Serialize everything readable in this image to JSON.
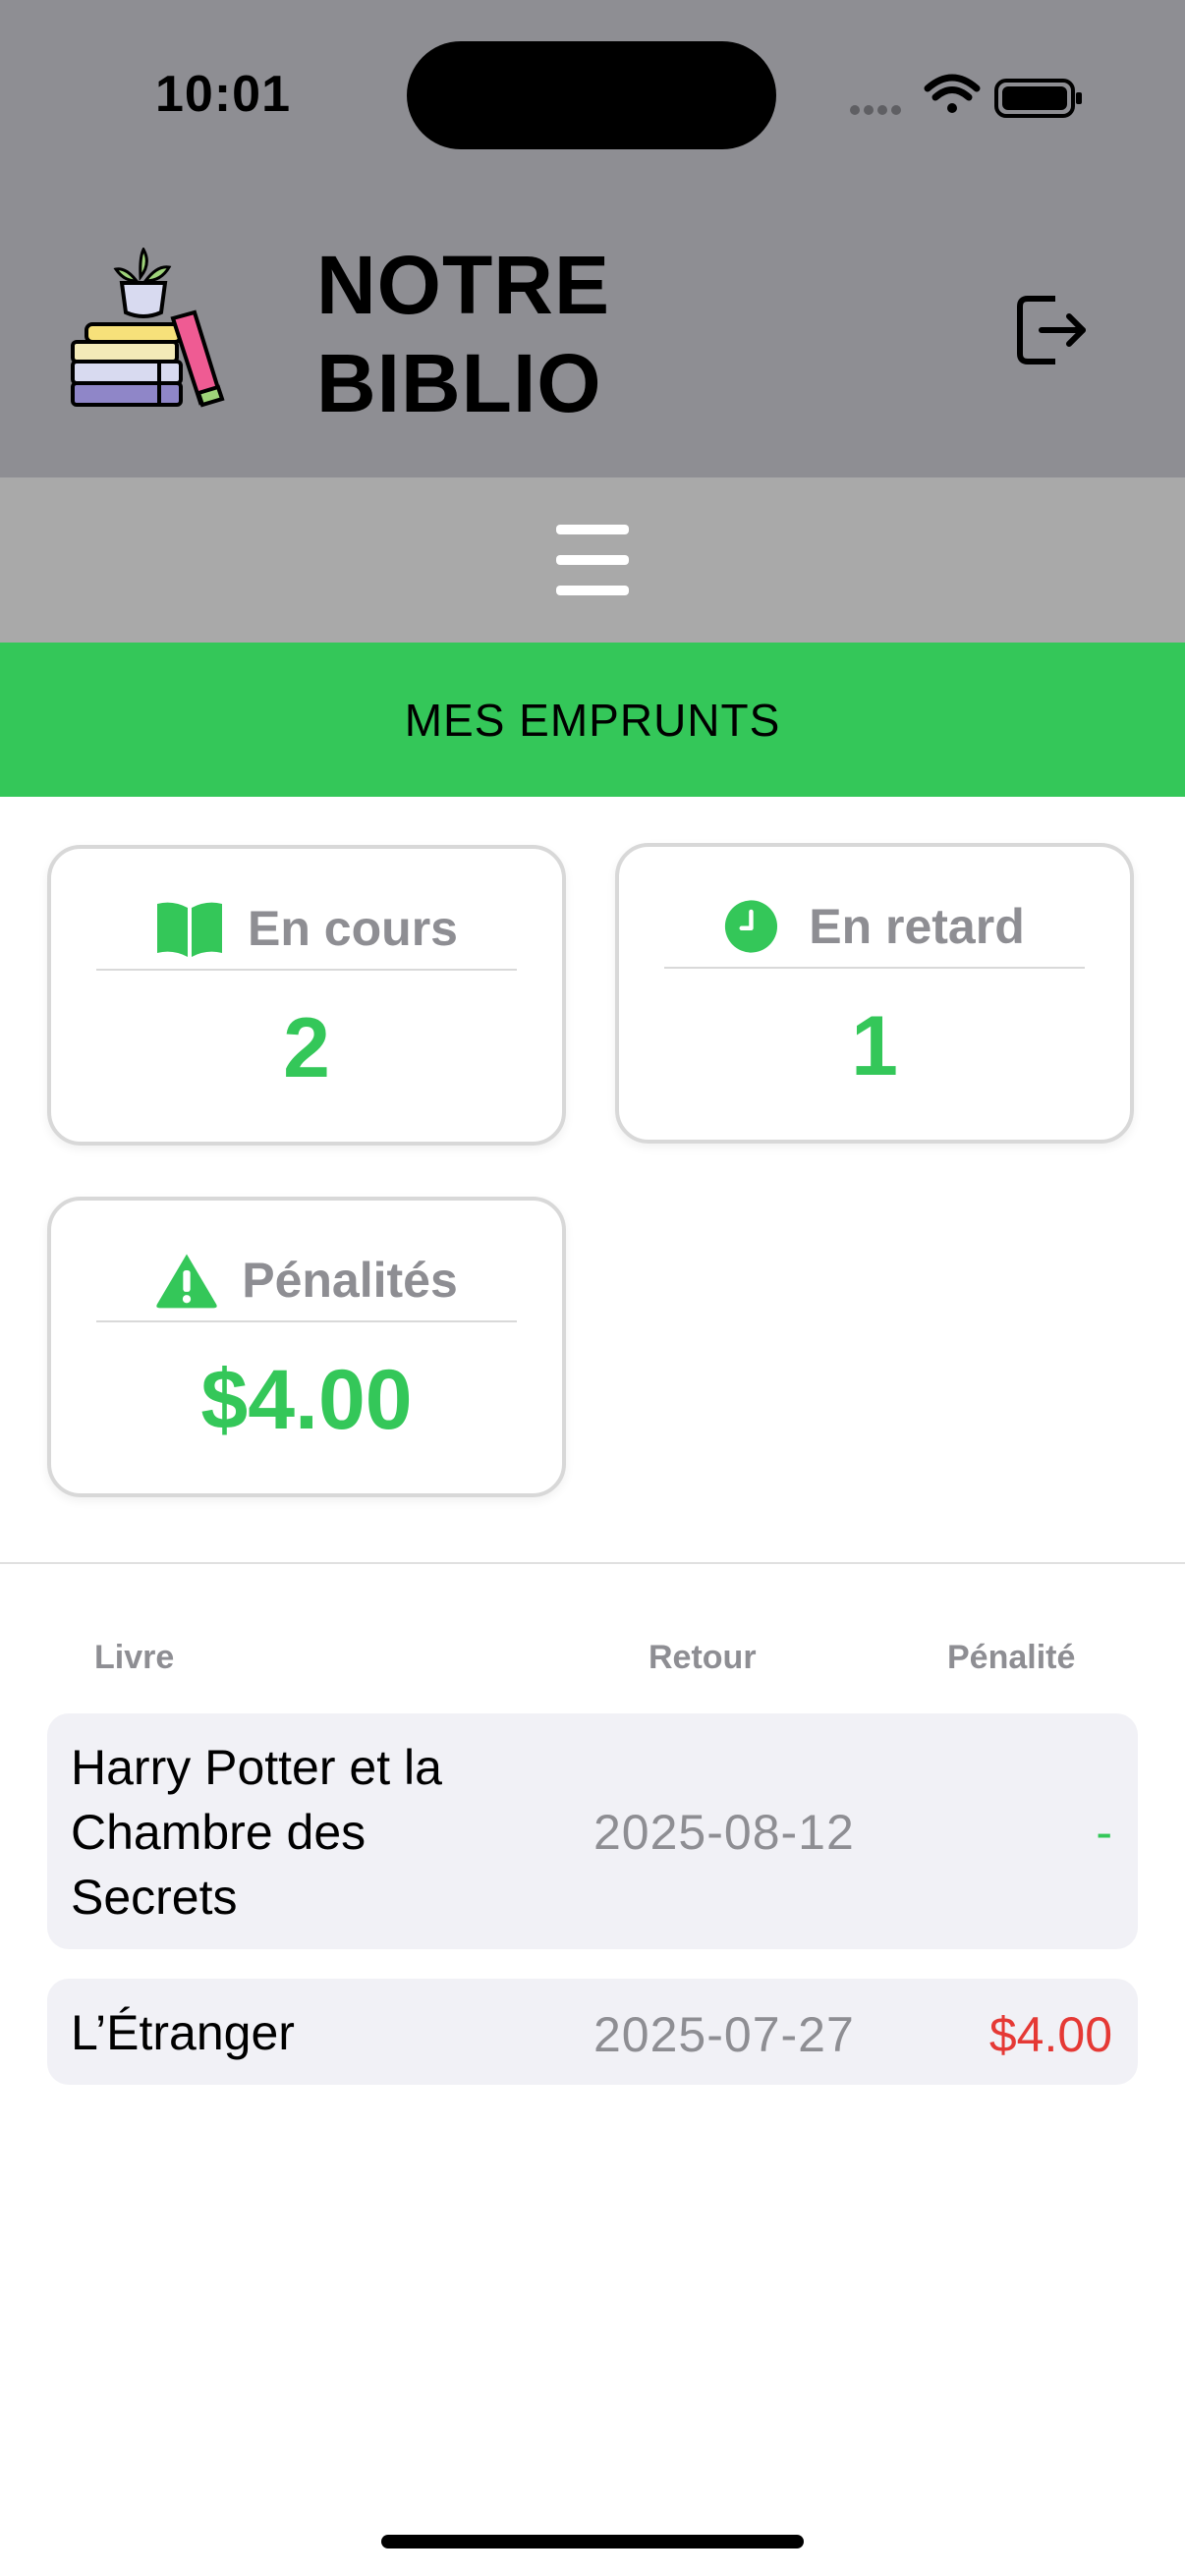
{
  "status_bar": {
    "time": "10:01"
  },
  "header": {
    "title_line1": "NOTRE",
    "title_line2": "BIBLIO"
  },
  "section": {
    "title": "MES EMPRUNTS"
  },
  "stats": [
    {
      "label": "En cours",
      "value": "2",
      "icon": "open-book-icon"
    },
    {
      "label": "En retard",
      "value": "1",
      "icon": "clock-icon"
    },
    {
      "label": "Pénalités",
      "value": "$4.00",
      "icon": "warning-icon"
    }
  ],
  "table": {
    "headers": {
      "book": "Livre",
      "return": "Retour",
      "penalty": "Pénalité"
    },
    "rows": [
      {
        "title_lines": [
          "Harry Potter et la",
          "Chambre des",
          "Secrets"
        ],
        "return_date": "2025-08-12",
        "penalty": "-"
      },
      {
        "title_lines": [
          "L’Étranger"
        ],
        "return_date": "2025-07-27",
        "penalty": "$4.00"
      }
    ]
  },
  "colors": {
    "accent_green": "#34c759",
    "penalty_red": "#e53935",
    "header_gray": "#8e8e93",
    "menu_gray": "#a9a9a9"
  }
}
